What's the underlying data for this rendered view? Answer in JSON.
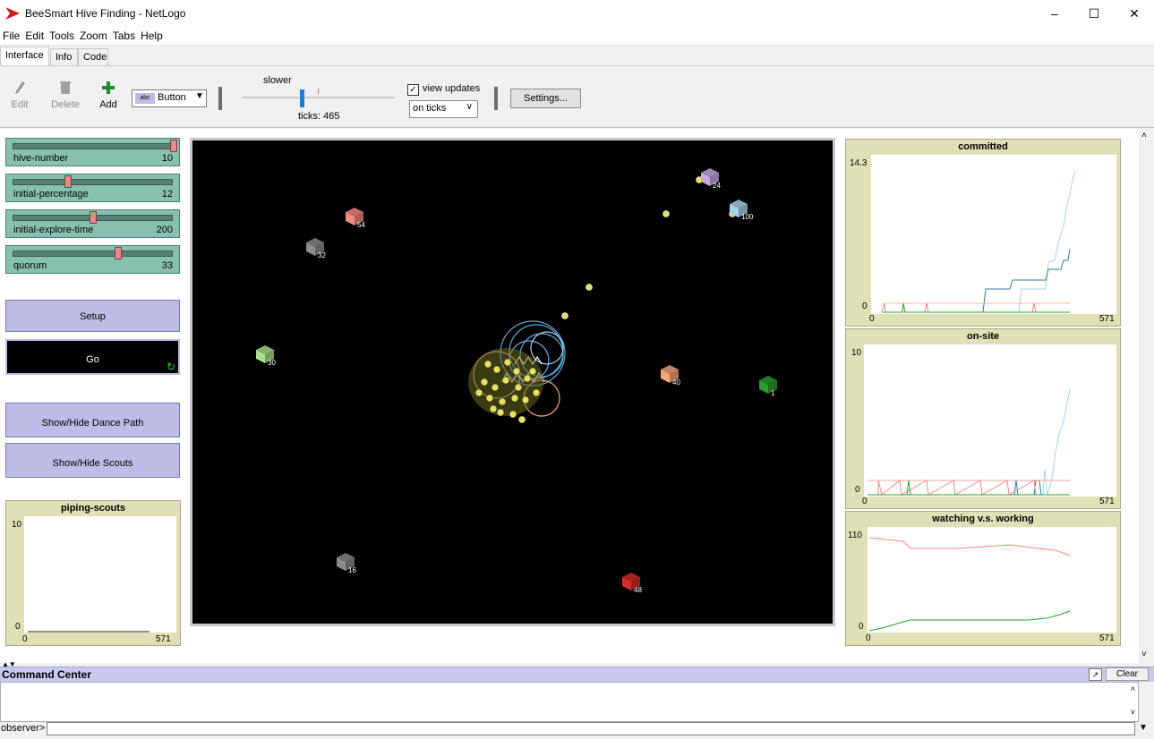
{
  "window": {
    "title": "BeeSmart Hive Finding - NetLogo"
  },
  "menu": [
    "File",
    "Edit",
    "Tools",
    "Zoom",
    "Tabs",
    "Help"
  ],
  "tabs": [
    "Interface",
    "Info",
    "Code"
  ],
  "toolbar": {
    "edit": "Edit",
    "delete": "Delete",
    "add": "Add",
    "widget_type": "Button",
    "speed_label": "slower",
    "ticks": "ticks: 465",
    "view_updates": "view updates",
    "update_mode": "on ticks",
    "settings": "Settings..."
  },
  "sliders": [
    {
      "name": "hive-number",
      "value": "10",
      "fraction": 1.0
    },
    {
      "name": "initial-percentage",
      "value": "12",
      "fraction": 0.36
    },
    {
      "name": "initial-explore-time",
      "value": "200",
      "fraction": 0.52
    },
    {
      "name": "quorum",
      "value": "33",
      "fraction": 0.68
    }
  ],
  "buttons": {
    "setup": "Setup",
    "go": "Go",
    "dance_path": "Show/Hide Dance Path",
    "scouts": "Show/Hide Scouts"
  },
  "plots": [
    {
      "title": "piping-scouts",
      "ymax": "10",
      "ymin": "0",
      "xmin": "0",
      "xmax": "571"
    },
    {
      "title": "committed",
      "ymax": "14.3",
      "ymin": "0",
      "xmin": "0",
      "xmax": "571"
    },
    {
      "title": "on-site",
      "ymax": "10",
      "ymin": "0",
      "xmin": "0",
      "xmax": "571"
    },
    {
      "title": "watching v.s. working",
      "ymax": "110",
      "ymin": "0",
      "xmin": "0",
      "xmax": "571"
    }
  ],
  "sites": [
    {
      "label": "54",
      "color": "#f08a80"
    },
    {
      "label": "32",
      "color": "#8c8c8c"
    },
    {
      "label": "30",
      "color": "#a8e08c"
    },
    {
      "label": "16",
      "color": "#8c8c8c"
    },
    {
      "label": "48",
      "color": "#d42c2c"
    },
    {
      "label": "40",
      "color": "#f5a57a"
    },
    {
      "label": "1",
      "color": "#2c9c2c"
    },
    {
      "label": "100",
      "color": "#a8d2f0"
    },
    {
      "label": "24",
      "color": "#c8a8e0"
    }
  ],
  "command_center": {
    "title": "Command Center",
    "clear": "Clear",
    "observer": "observer>"
  }
}
